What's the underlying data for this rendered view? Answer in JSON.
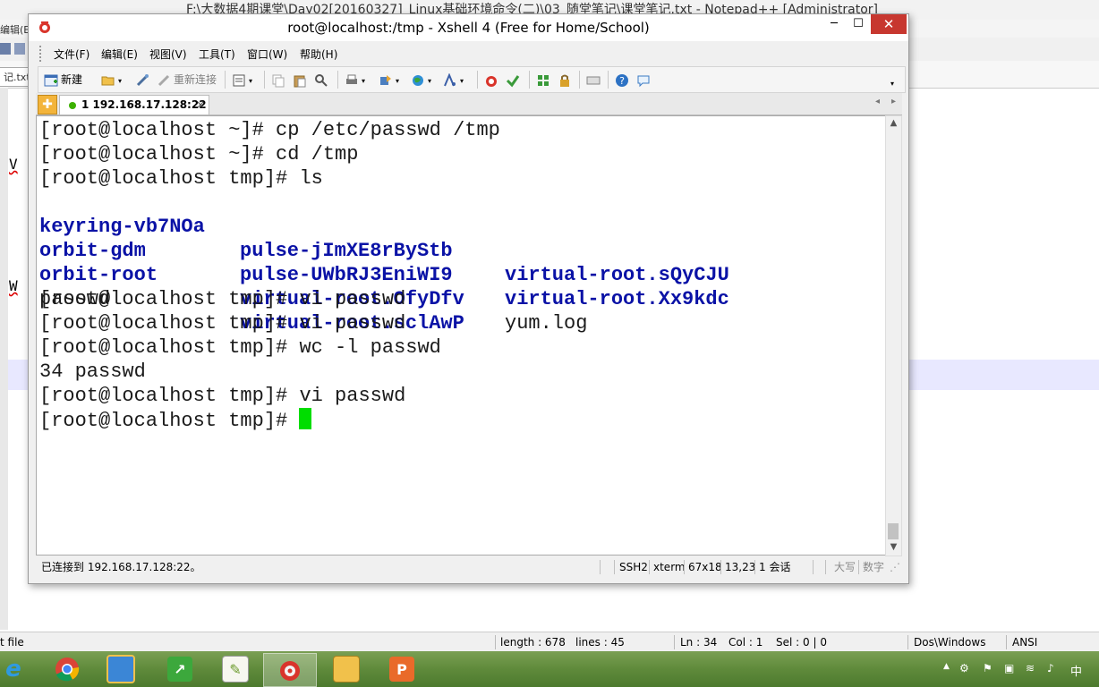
{
  "notepadpp": {
    "title": "F:\\大数据4期课堂\\Day02[20160327]_Linux基础环境命令(二)\\03_随堂笔记\\课堂笔记.txt - Notepad++ [Administrator]",
    "menu_edit_fragment": "编辑(E)",
    "tab_fragment": "记.txt",
    "text_fragment_1": "V",
    "text_fragment_2": "W",
    "status": {
      "filetype": "t file",
      "length": "length : 678",
      "lines": "lines : 45",
      "ln": "Ln : 34",
      "col": "Col : 1",
      "sel": "Sel : 0 | 0",
      "eol": "Dos\\Windows",
      "encoding": "ANSI"
    }
  },
  "xshell": {
    "title": "root@localhost:/tmp - Xshell 4 (Free for Home/School)",
    "window_buttons": {
      "minimize": "─",
      "maximize": "☐",
      "close": "✕"
    },
    "menu": [
      "文件(F)",
      "编辑(E)",
      "视图(V)",
      "工具(T)",
      "窗口(W)",
      "帮助(H)"
    ],
    "toolbar": {
      "new_label": "新建",
      "reconnect_label": "重新连接"
    },
    "tab": {
      "new_symbol": "✚",
      "session_label": "1 192.168.17.128:22",
      "close_symbol": "×",
      "scroll_left": "◂",
      "scroll_right": "▸"
    },
    "terminal": {
      "lines": [
        "[root@localhost ~]# cp /etc/passwd /tmp",
        "[root@localhost ~]# cd /tmp",
        "[root@localhost tmp]# ls"
      ],
      "ls_rows": [
        [
          "keyring-vb7NOa",
          "pulse-jImXE8rByStb",
          "virtual-root.sQyCJU"
        ],
        [
          "orbit-gdm",
          "pulse-UWbRJ3EniWI9",
          "virtual-root.Xx9kdc"
        ],
        [
          "orbit-root",
          "virtual-root.OfyDfv",
          "yum.log"
        ],
        [
          "passwd",
          "virtual-root.sclAwP",
          ""
        ]
      ],
      "after_lines": [
        "[root@localhost tmp]# vi passwd",
        "[root@localhost tmp]# vi passwd",
        "[root@localhost tmp]# wc -l passwd",
        "34 passwd",
        "[root@localhost tmp]# vi passwd"
      ],
      "prompt": "[root@localhost tmp]# "
    },
    "status": {
      "connection": "已连接到 192.168.17.128:22。",
      "protocol": "SSH2",
      "terminal_type": "xterm",
      "size": "67x18",
      "cursor_pos": "13,23",
      "sessions": "1 会话",
      "caps": "大写",
      "num": "数字"
    }
  },
  "taskbar": {
    "tray_ime": "中"
  },
  "colors": {
    "terminal_dir": "#0a12a6",
    "cursor": "#00dd00",
    "close_button": "#c7372f",
    "taskbar": "#5f8a3b"
  }
}
